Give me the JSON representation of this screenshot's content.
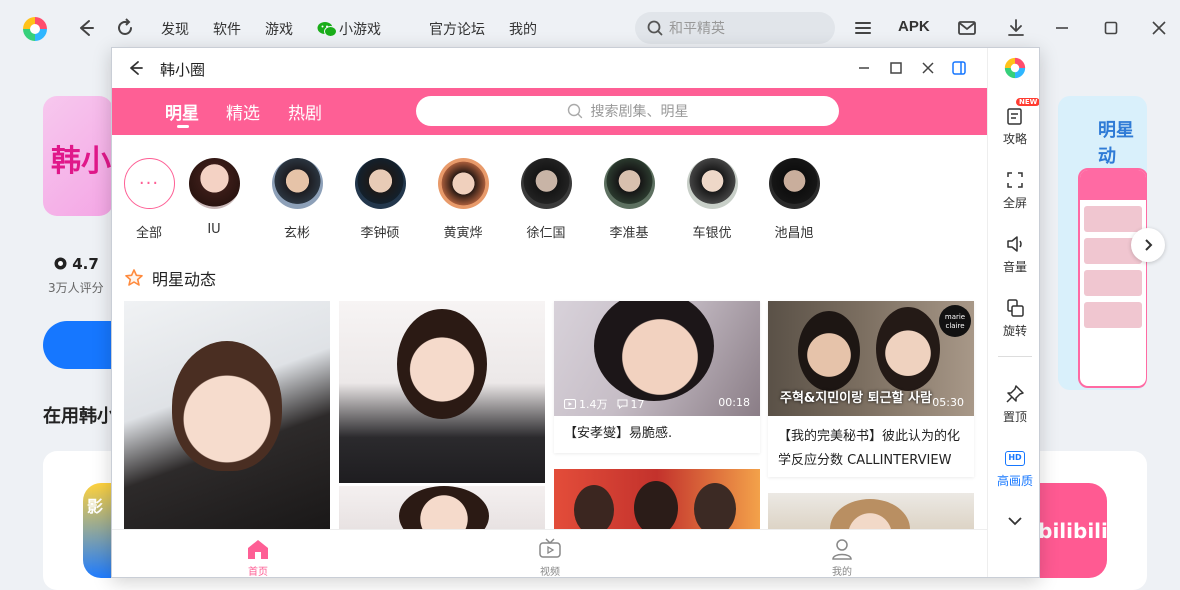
{
  "app": {
    "nav": [
      "发现",
      "软件",
      "游戏",
      "小游戏",
      "官方论坛",
      "我的"
    ],
    "search_placeholder": "和平精英",
    "apk_label": "APK"
  },
  "background": {
    "card_text": "韩小",
    "rating": "4.7",
    "rating_sub": "3万人评分",
    "in_use": "在用韩小",
    "right_card_title": "明星动",
    "app2_text": "bilibili"
  },
  "window": {
    "title": "韩小圈",
    "tabs": [
      {
        "label": "明星",
        "active": true
      },
      {
        "label": "精选",
        "active": false
      },
      {
        "label": "热剧",
        "active": false
      }
    ],
    "search_placeholder": "搜索剧集、明星",
    "stars": [
      {
        "name": "全部",
        "avatar": "more-icon"
      },
      {
        "name": "IU"
      },
      {
        "name": "玄彬"
      },
      {
        "name": "李钟硕"
      },
      {
        "name": "黄寅烨"
      },
      {
        "name": "徐仁国"
      },
      {
        "name": "李准基"
      },
      {
        "name": "车银优"
      },
      {
        "name": "池昌旭"
      }
    ],
    "section_title": "明星动态",
    "cards": [
      {
        "views": "1.4万",
        "comments": "17",
        "duration": "00:18",
        "caption": "【安孝燮】易脆感."
      },
      {
        "overlay_text": "주혁&지민이랑 퇴근할 사람",
        "brand": "marie claire",
        "duration": "05:30",
        "caption": "【我的完美秘书】彼此认为的化学反应分数 CALLINTERVIEW"
      }
    ],
    "bottom_nav": [
      {
        "label": "首页",
        "active": true
      },
      {
        "label": "视频",
        "active": false
      },
      {
        "label": "我的",
        "active": false
      }
    ],
    "sidebar": [
      {
        "label": "攻略",
        "badge": "NEW"
      },
      {
        "label": "全屏"
      },
      {
        "label": "音量"
      },
      {
        "label": "旋转"
      },
      {
        "label": "置顶"
      },
      {
        "label": "高画质",
        "icon_text": "HD"
      }
    ]
  },
  "colors": {
    "accent_pink": "#fe5f95",
    "blue": "#1677ff"
  }
}
